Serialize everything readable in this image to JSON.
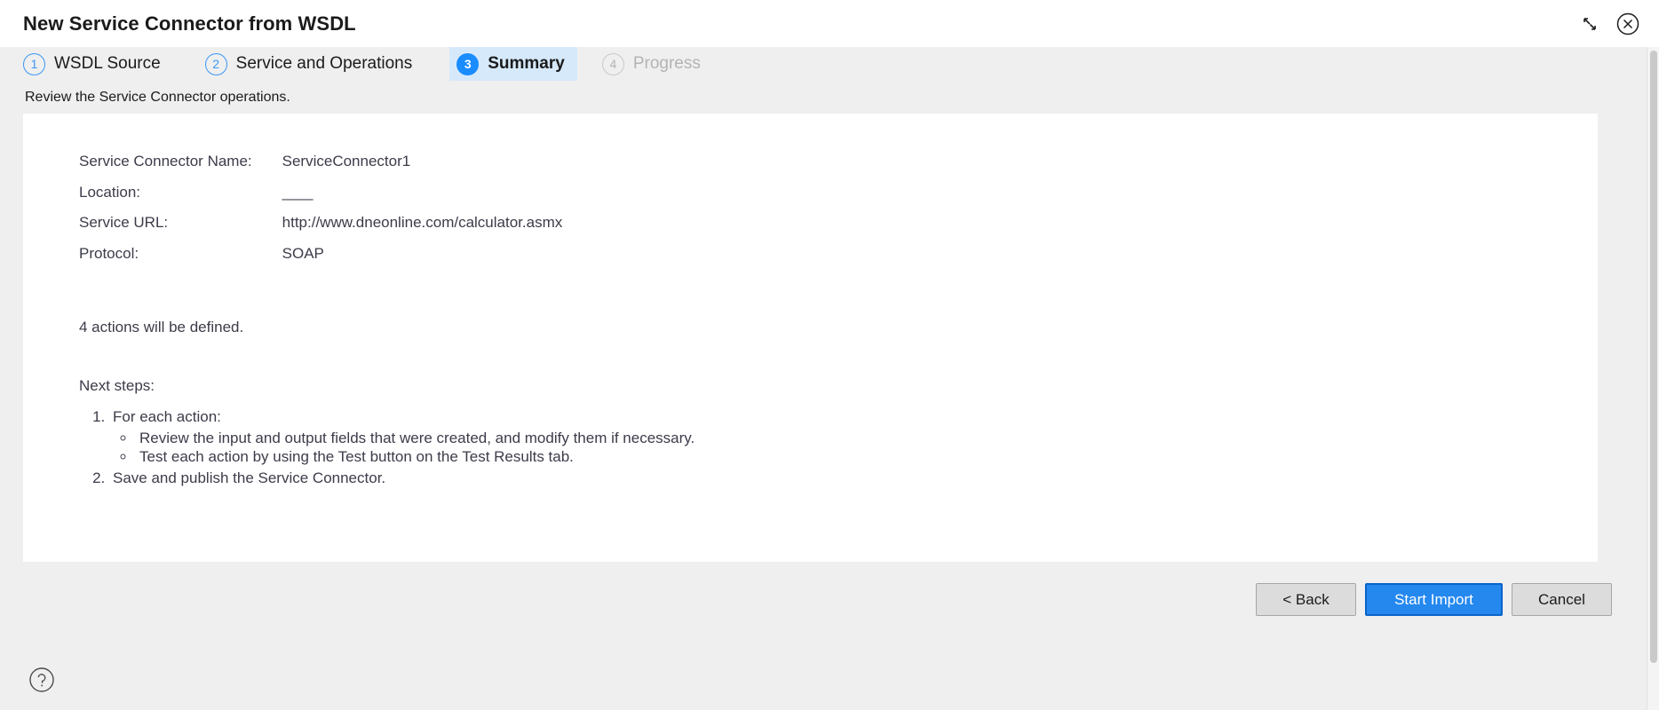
{
  "window": {
    "title": "New Service Connector from WSDL",
    "restore_icon": "restore-down-icon",
    "close_icon": "close-icon"
  },
  "steps": [
    {
      "number": "1",
      "label": "WSDL Source",
      "state": "completed"
    },
    {
      "number": "2",
      "label": "Service and Operations",
      "state": "completed"
    },
    {
      "number": "3",
      "label": "Summary",
      "state": "active"
    },
    {
      "number": "4",
      "label": "Progress",
      "state": "disabled"
    }
  ],
  "main": {
    "instruction": "Review the Service Connector operations.",
    "details": [
      {
        "key": "Service Connector Name:",
        "value": "ServiceConnector1"
      },
      {
        "key": "Location:",
        "value": "____"
      },
      {
        "key": "Service URL:",
        "value": "http://www.dneonline.com/calculator.asmx"
      },
      {
        "key": "Protocol:",
        "value": "SOAP"
      }
    ],
    "actions_summary": "4 actions will be defined.",
    "next_steps_heading": "Next steps:",
    "next_steps": [
      {
        "text": "For each action:",
        "sub_items": [
          "Review the input and output fields that were created, and modify them if necessary.",
          "Test each action by using the Test button on the Test Results tab."
        ]
      },
      {
        "text": "Save and publish the Service Connector.",
        "sub_items": []
      }
    ]
  },
  "footer": {
    "back_label": "< Back",
    "start_import_label": "Start Import",
    "cancel_label": "Cancel",
    "help_icon": "help-icon"
  },
  "colors": {
    "accent": "#1a8cff",
    "primary_button": "#2488ef",
    "primary_button_border": "#0a63c9",
    "active_step_background": "#d6e9fb",
    "page_background": "#efefef",
    "panel_background": "#ffffff",
    "text": "#3c3c4a"
  }
}
